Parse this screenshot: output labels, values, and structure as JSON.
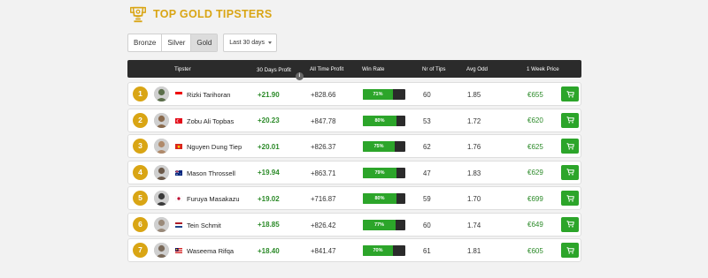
{
  "title": "TOP GOLD TIPSTERS",
  "icons": {
    "title": "trophy-icon",
    "cart": "shopping-cart-icon",
    "info": "info-icon"
  },
  "colors": {
    "gold": "#d9a514",
    "green": "#2ca52a",
    "profit_green": "#2b8a28",
    "header_bg": "#2b2b2b"
  },
  "filters": {
    "tiers": [
      {
        "label": "Bronze",
        "active": false
      },
      {
        "label": "Silver",
        "active": false
      },
      {
        "label": "Gold",
        "active": true
      }
    ],
    "period": "Last 30 days"
  },
  "table": {
    "headers": {
      "tipster": "Tipster",
      "profit30": "30 Days Profit",
      "info": "i",
      "profit_all": "All Time Profit",
      "win_rate": "Win Rate",
      "tips": "Nr of Tips",
      "avg_odd": "Avg Odd",
      "price": "1 Week Price"
    },
    "rows": [
      {
        "rank": "1",
        "name": "Rizki Tarihoran",
        "country_flag": "Indonesia",
        "profit30": "+21.90",
        "profit_all": "+828.66",
        "win_rate": "71%",
        "win_fraction": 0.71,
        "tips": "60",
        "avg_odd": "1.85",
        "price": "€655"
      },
      {
        "rank": "2",
        "name": "Zobu Ali Topbas",
        "country_flag": "Turkey",
        "profit30": "+20.23",
        "profit_all": "+847.78",
        "win_rate": "80%",
        "win_fraction": 0.8,
        "tips": "53",
        "avg_odd": "1.72",
        "price": "€620"
      },
      {
        "rank": "3",
        "name": "Nguyen Dung Tiep",
        "country_flag": "Vietnam",
        "profit30": "+20.01",
        "profit_all": "+826.37",
        "win_rate": "75%",
        "win_fraction": 0.75,
        "tips": "62",
        "avg_odd": "1.76",
        "price": "€625"
      },
      {
        "rank": "4",
        "name": "Mason Throssell",
        "country_flag": "Australia",
        "profit30": "+19.94",
        "profit_all": "+863.71",
        "win_rate": "79%",
        "win_fraction": 0.79,
        "tips": "47",
        "avg_odd": "1.83",
        "price": "€629"
      },
      {
        "rank": "5",
        "name": "Furuya Masakazu",
        "country_flag": "Japan",
        "profit30": "+19.02",
        "profit_all": "+716.87",
        "win_rate": "80%",
        "win_fraction": 0.8,
        "tips": "59",
        "avg_odd": "1.70",
        "price": "€699"
      },
      {
        "rank": "6",
        "name": "Tein Schmit",
        "country_flag": "Netherlands",
        "profit30": "+18.85",
        "profit_all": "+826.42",
        "win_rate": "77%",
        "win_fraction": 0.77,
        "tips": "60",
        "avg_odd": "1.74",
        "price": "€649"
      },
      {
        "rank": "7",
        "name": "Waseema Rifqa",
        "country_flag": "Malaysia",
        "profit30": "+18.40",
        "profit_all": "+841.47",
        "win_rate": "70%",
        "win_fraction": 0.7,
        "tips": "61",
        "avg_odd": "1.81",
        "price": "€605"
      }
    ]
  }
}
